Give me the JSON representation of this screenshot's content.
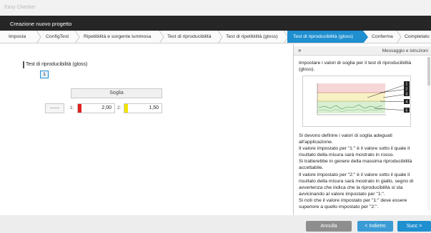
{
  "window": {
    "title": "Easy Checker"
  },
  "header": {
    "title": "Creazione nuovo progetto"
  },
  "steps": [
    {
      "label": "Imposta"
    },
    {
      "label": "ConfigTest"
    },
    {
      "label": "Ripetibilità e sorgente luminosa"
    },
    {
      "label": "Test di riproducibilità"
    },
    {
      "label": "Test di ripetibilità (gloss)"
    },
    {
      "label": "Test di riproducibilità (gloss)",
      "active": true
    },
    {
      "label": "Conferma"
    },
    {
      "label": "Completato"
    }
  ],
  "section": {
    "title": "Test di riproducibilità (gloss)",
    "index": "1",
    "threshold_header": "Soglia",
    "dash_button": "------",
    "threshold1_label": "1:",
    "threshold1_value": "2,00",
    "threshold2_label": "2:",
    "threshold2_value": "1,50"
  },
  "panel": {
    "collapse": "»",
    "title": "Messaggio e istruzioni",
    "intro": "Impostare i valori di soglia per il test di riproducibilità (gloss).",
    "figure_callouts": [
      "1",
      "2",
      "3",
      "4",
      "5"
    ],
    "notes": [
      "Si devono definire i valori di soglia adeguati all'applicazione.",
      "Il valore impostato per \"1:\" è il valore sotto il quale il risultato della misura sarà mostrato in rosso.",
      "Si tratterebbe in genere della massima riproducibilità accettabile.",
      "Il valore impostato per \"2:\" è il valore sotto il quale il risultato della misura sarà mostrato in giallo, segno di avvertenza che indica che la riproducibilità si sta avvicinando al valore impostato per \"1:\".",
      "Si noti che il valore impostato per \"1:\" deve essere superiore a quello impostato per \"2:\"."
    ]
  },
  "footer": {
    "cancel": "Annulla",
    "back": "< Indietro",
    "next": "Succ >"
  },
  "colors": {
    "accent": "#1f8fd0",
    "threshold1": "#e02020",
    "threshold2": "#f2e400",
    "header_bg": "#262626"
  }
}
